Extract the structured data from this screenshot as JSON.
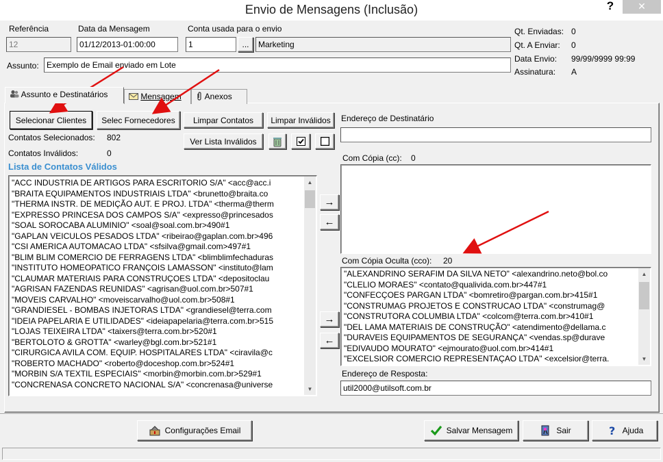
{
  "window": {
    "title": "Envio de Mensagens (Inclusão)",
    "help": "?",
    "close": "✕"
  },
  "header": {
    "referencia_label": "Referência",
    "referencia_value": "12",
    "data_label": "Data da Mensagem",
    "data_value": "01/12/2013-01:00:00",
    "conta_label": "Conta usada para o envio",
    "conta_value": "1",
    "conta_browse": "...",
    "conta_name": "Marketing",
    "assunto_label": "Assunto:",
    "assunto_value": "Exemplo de Email enviado em Lote"
  },
  "stats": {
    "enviadas_label": "Qt. Enviadas:",
    "enviadas_value": "0",
    "a_enviar_label": "Qt. A Enviar:",
    "a_enviar_value": "0",
    "data_envio_label": "Data Envio:",
    "data_envio_value": "99/99/9999 99:99",
    "assinatura_label": "Assinatura:",
    "assinatura_value": "A"
  },
  "tabs": [
    {
      "label": "Assunto e Destinatários",
      "icon": "people-icon"
    },
    {
      "label": "Mensagem",
      "icon": "envelope-icon"
    },
    {
      "label": "Anexos",
      "icon": "paperclip-icon"
    }
  ],
  "contacts": {
    "selecionar_clientes": "Selecionar Clientes",
    "selec_fornecedores": "Selec Fornecedores",
    "limpar_contatos": "Limpar Contatos",
    "limpar_invalidos": "Limpar Inválidos",
    "ver_lista_invalidos": "Ver Lista Inválidos",
    "selecionados_label": "Contatos Selecionados:",
    "selecionados_value": "802",
    "invalidos_label": "Contatos Inválidos:",
    "invalidos_value": "0",
    "list_title": "Lista de Contatos Válidos",
    "items": [
      "\"ACC INDUSTRIA DE ARTIGOS PARA ESCRITORIO S/A\" <acc@acc.i",
      "\"BRAITA EQUIPAMENTOS INDUSTRIAIS LTDA\" <brunetto@braita.co",
      "\"THERMA INSTR. DE MEDIÇÃO AUT. E PROJ. LTDA\" <therma@therm",
      "\"EXPRESSO PRINCESA DOS CAMPOS S/A\" <expresso@princesados",
      "\"SOAL SOROCABA ALUMINIO\" <soal@soal.com.br>490#1",
      "\"GAPLAN VEICULOS PESADOS LTDA\" <ribeirao@gaplan.com.br>496",
      "\"CSI AMERICA AUTOMACAO LTDA\" <sfsilva@gmail.com>497#1",
      "\"BLIM BLIM COMERCIO DE FERRAGENS LTDA\" <blimblimfechaduras",
      "\"INSTITUTO HOMEOPATICO FRANÇOIS LAMASSON\" <instituto@lam",
      "\"CLAUMAR MATERIAIS PARA CONSTRUÇOES LTDA\" <depositoclau",
      "\"AGRISAN FAZENDAS REUNIDAS\" <agrisan@uol.com.br>507#1",
      "\"MOVEIS CARVALHO\" <moveiscarvalho@uol.com.br>508#1",
      "\"GRANDIESEL - BOMBAS INJETORAS LTDA\" <grandiesel@terra.com",
      "\"IDEIA PAPELARIA E UTILIDADES\" <ideiapapelaria@terra.com.br>515",
      "\"LOJAS TEIXEIRA LTDA\" <taixers@terra.com.br>520#1",
      "\"BERTOLOTO & GROTTA\" <warley@bgl.com.br>521#1",
      "\"CIRURGICA AVILA COM. EQUIP. HOSPITALARES LTDA\" <ciravila@c",
      "\"ROBERTO MACHADO\" <roberto@doceshop.com.br>524#1",
      "\"MORBIN S/A TEXTIL ESPECIAIS\" <morbin@morbin.com.br>529#1",
      "\"CONCRENASA CONCRETO NACIONAL S/A\" <concrenasa@universe"
    ]
  },
  "recipients": {
    "destinatario_label": "Endereço de Destinatário",
    "destinatario_value": "",
    "cc_label": "Com Cópia (cc):",
    "cc_count": "0",
    "cc_items": [],
    "cco_label": "Com Cópia Oculta (cco):",
    "cco_count": "20",
    "cco_items": [
      "\"ALEXANDRINO SERAFIM DA SILVA NETO\" <alexandrino.neto@bol.co",
      "\"CLELIO MORAES\" <contato@qualivida.com.br>447#1",
      "\"CONFECÇOES PARGAN LTDA\" <bomretiro@pargan.com.br>415#1",
      "\"CONSTRUMAG PROJETOS E CONSTRUCAO LTDA\" <construmag@",
      "\"CONSTRUTORA COLUMBIA LTDA\" <colcom@terra.com.br>410#1",
      "\"DEL LAMA MATERIAIS DE CONSTRUÇÃO\" <atendimento@dellama.c",
      "\"DURAVEIS EQUIPAMENTOS DE SEGURANÇA\" <vendas.sp@durave",
      "\"EDIVAUDO MOURATO\" <ejmourato@uol.com.br>414#1",
      "\"EXCELSIOR COMERCIO REPRESENTAÇAO LTDA\" <excelsior@terra."
    ],
    "resposta_label": "Endereço de Resposta:",
    "resposta_value": "util2000@utilsoft.com.br",
    "move_right": "→",
    "move_left": "←"
  },
  "footer": {
    "config_email": "Configurações Email",
    "salvar": "Salvar Mensagem",
    "sair": "Sair",
    "ajuda": "Ajuda"
  },
  "colors": {
    "annotation_arrow": "#e01010",
    "list_title": "#3a8fd0"
  }
}
